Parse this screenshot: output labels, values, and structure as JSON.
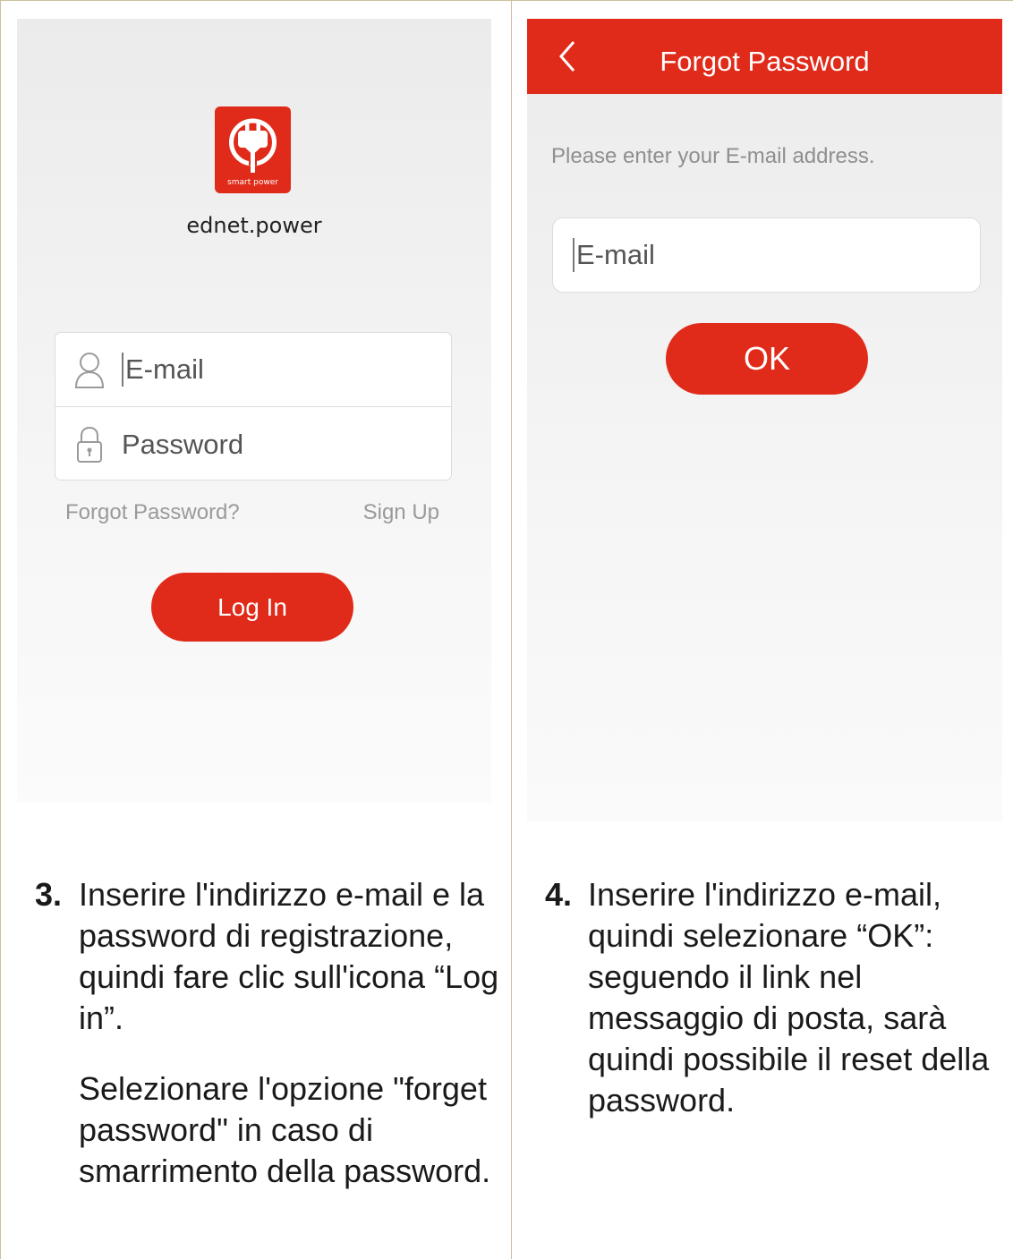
{
  "login_screen": {
    "logo_caption": "smart power",
    "app_name": "ednet.power",
    "email_placeholder": "E-mail",
    "password_placeholder": "Password",
    "forgot_link": "Forgot Password?",
    "signup_link": "Sign Up",
    "login_button": "Log In",
    "accent_color": "#e02b1a"
  },
  "forgot_screen": {
    "title": "Forgot Password",
    "back_icon": "chevron-left-icon",
    "hint": "Please enter your E-mail address.",
    "email_placeholder": "E-mail",
    "ok_button": "OK"
  },
  "captions": {
    "step3": {
      "number": "3.",
      "text": "Inserire l'indirizzo e-mail e la password di registrazione, quindi fare clic sull'icona “Log in”.",
      "text2": "Selezionare l'opzione \"forget password\" in caso di smarrimento della password."
    },
    "step4": {
      "number": "4.",
      "text": "Inserire l'indirizzo e-mail, quindi selezionare “OK”: seguendo il link nel messaggio di posta, sarà quindi possibile il reset della password."
    }
  }
}
